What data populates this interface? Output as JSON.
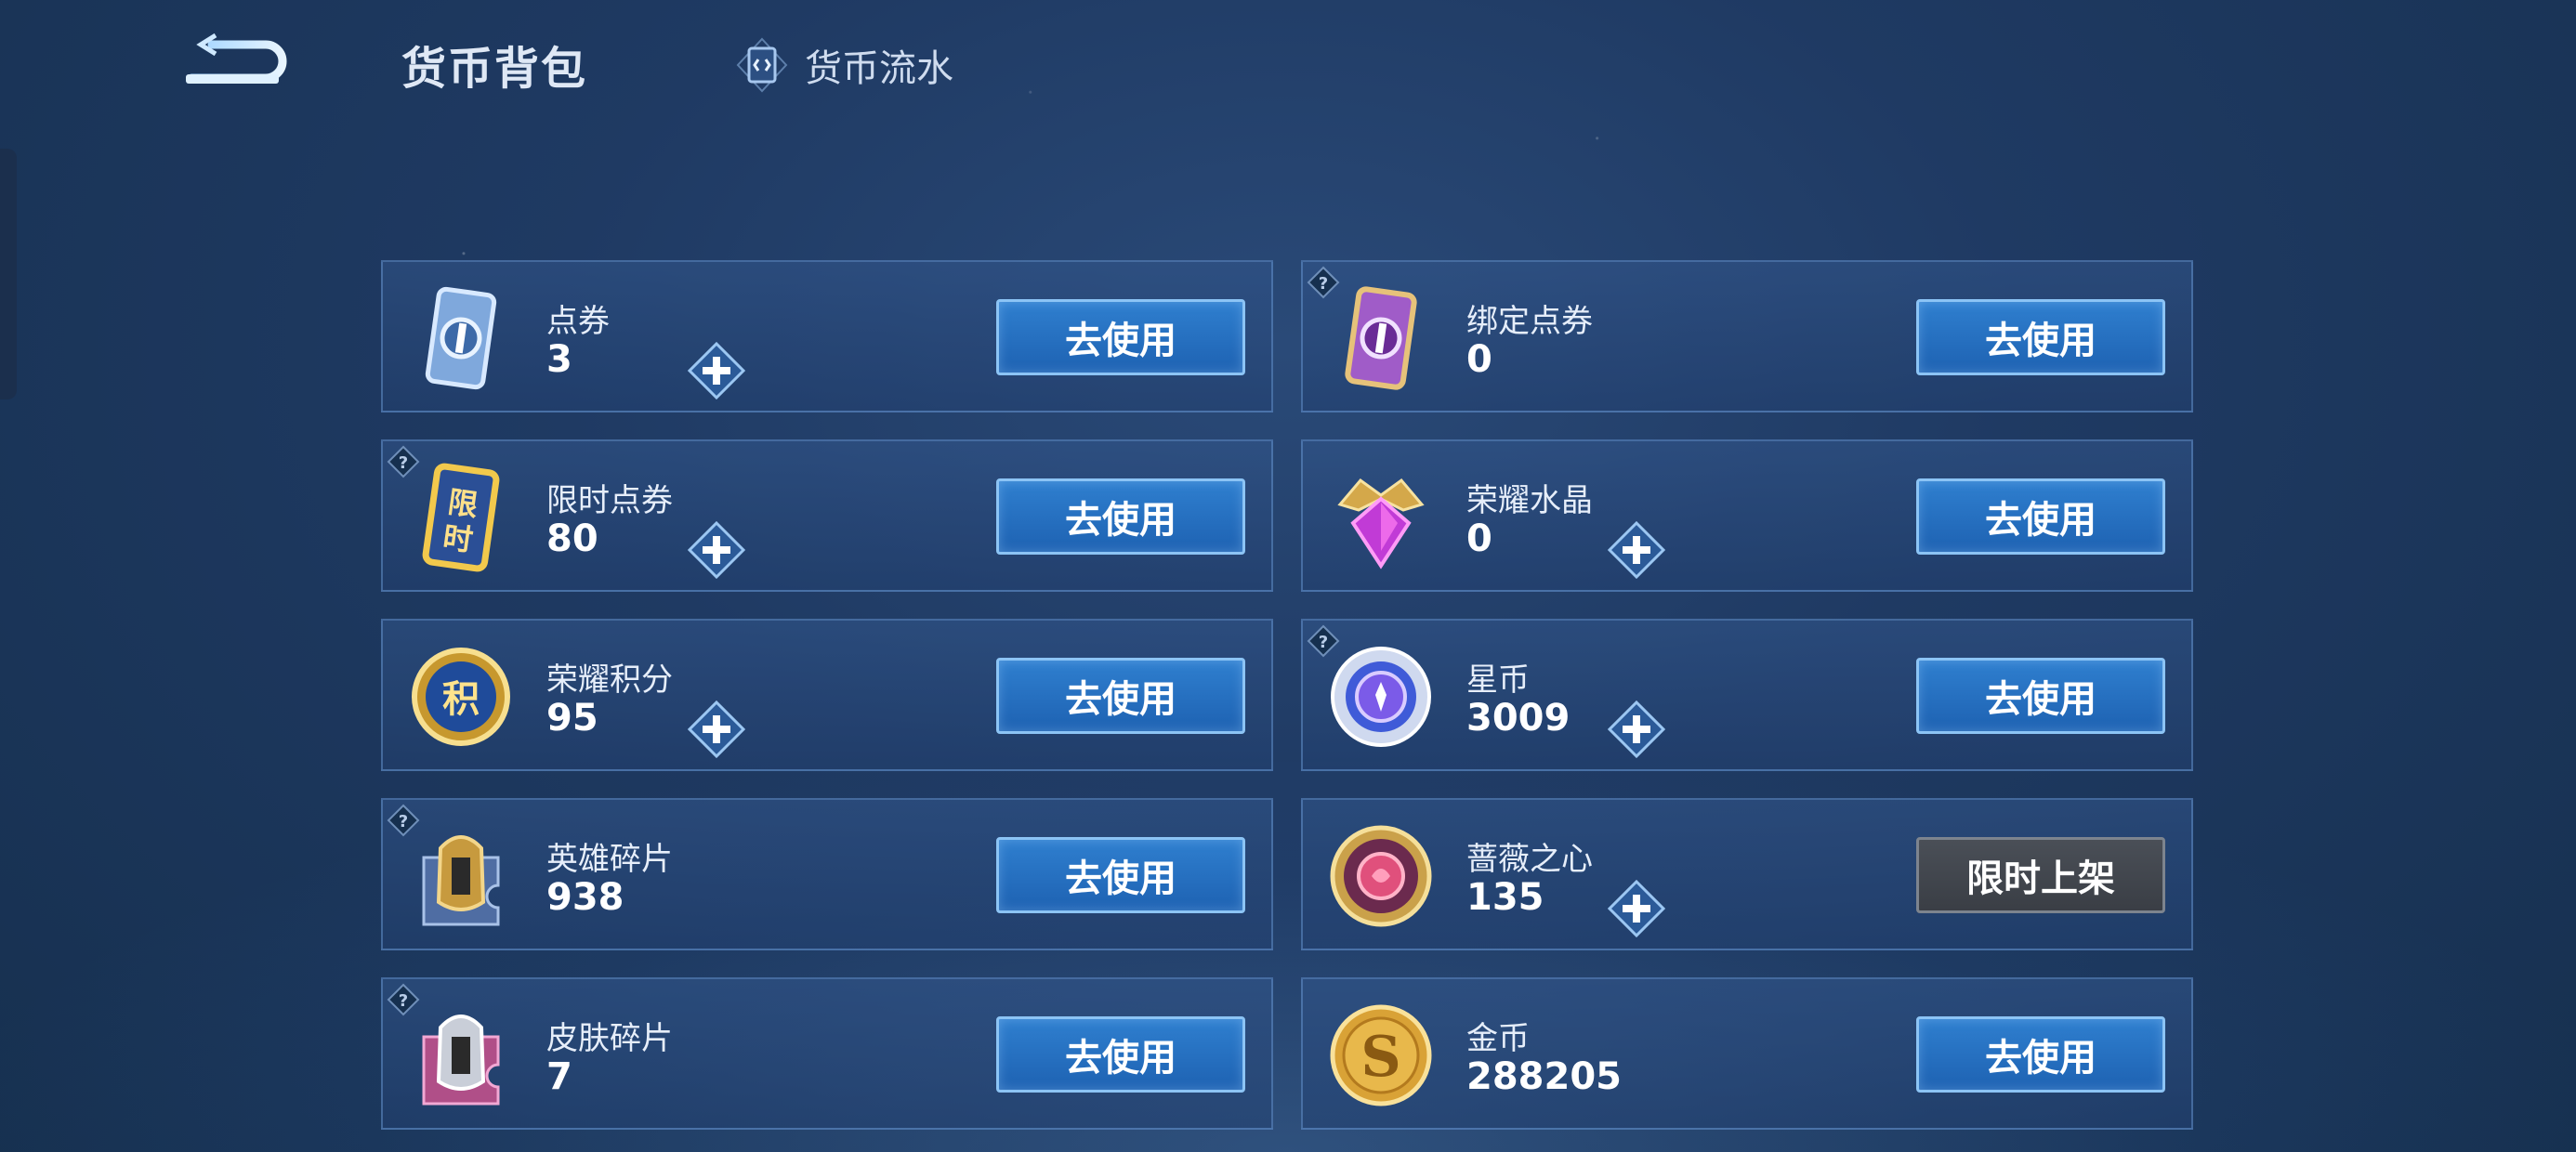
{
  "header": {
    "title": "货币背包",
    "flow_link": "货币流水",
    "back_icon": "back-arrow-icon"
  },
  "currencies": [
    {
      "name": "点券",
      "value": "3",
      "button": "去使用",
      "icon": "ticket-blue-icon",
      "has_plus": true,
      "has_help": false
    },
    {
      "name": "绑定点券",
      "value": "0",
      "button": "去使用",
      "icon": "ticket-purple-icon",
      "has_plus": false,
      "has_help": true
    },
    {
      "name": "限时点券",
      "value": "80",
      "button": "去使用",
      "icon": "limited-ticket-icon",
      "has_plus": true,
      "has_help": true
    },
    {
      "name": "荣耀水晶",
      "value": "0",
      "button": "去使用",
      "icon": "glory-crystal-icon",
      "has_plus": true,
      "has_help": false
    },
    {
      "name": "荣耀积分",
      "value": "95",
      "button": "去使用",
      "icon": "glory-points-icon",
      "has_plus": true,
      "has_help": false
    },
    {
      "name": "星币",
      "value": "3009",
      "button": "去使用",
      "icon": "star-coin-icon",
      "has_plus": true,
      "has_help": true
    },
    {
      "name": "英雄碎片",
      "value": "938",
      "button": "去使用",
      "icon": "hero-fragment-icon",
      "has_plus": false,
      "has_help": true
    },
    {
      "name": "蔷薇之心",
      "value": "135",
      "button": "限时上架",
      "icon": "rose-heart-icon",
      "has_plus": true,
      "has_help": false
    },
    {
      "name": "皮肤碎片",
      "value": "7",
      "button": "去使用",
      "icon": "skin-fragment-icon",
      "has_plus": false,
      "has_help": true
    },
    {
      "name": "金币",
      "value": "288205",
      "button": "去使用",
      "icon": "gold-coin-icon",
      "has_plus": false,
      "has_help": false
    }
  ],
  "colors": {
    "button_blue": "#1e62b2",
    "button_border": "#8cc4f5",
    "button_disabled": "#3a3e45",
    "background": "#1f3a63"
  }
}
